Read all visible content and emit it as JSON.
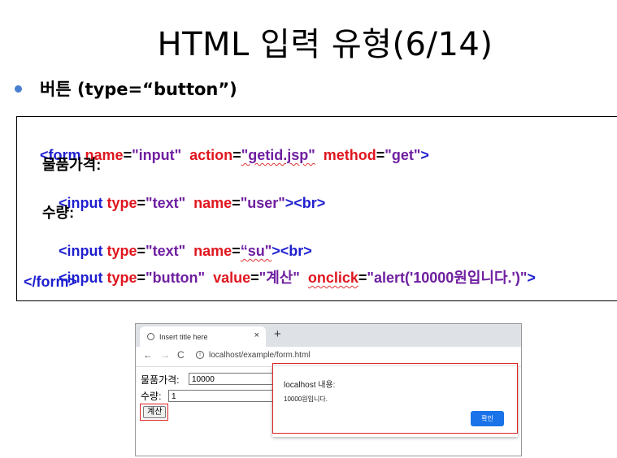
{
  "slide": {
    "title": "HTML 입력 유형(6/14)",
    "bullet": "버튼 (type=“button”)"
  },
  "code": {
    "l1_a": "<form ",
    "l1_b": "name",
    "l1_c": "=",
    "l1_d": "\"input\"",
    "l1_e": "  ",
    "l1_f": "action",
    "l1_g": "=",
    "l1_h": "\"getid.jsp\"",
    "l1_i": "  ",
    "l1_j": "method",
    "l1_k": "=",
    "l1_l": "\"get\"",
    "l1_m": ">",
    "l2": "물품가격:",
    "l3_a": "<input ",
    "l3_b": "type",
    "l3_c": "=",
    "l3_d": "\"text\"",
    "l3_e": "  ",
    "l3_f": "name",
    "l3_g": "=",
    "l3_h": "\"user\"",
    "l3_i": "><br>",
    "l4": "수량:",
    "l5_a": "<input ",
    "l5_b": "type",
    "l5_c": "=",
    "l5_d": "\"text\"",
    "l5_e": "  ",
    "l5_f": "name",
    "l5_g": "=",
    "l5_h": "“su\"",
    "l5_i": "><br>",
    "l6_a": "<input ",
    "l6_b": "type",
    "l6_c": "=",
    "l6_d": "\"button\"",
    "l6_e": "  ",
    "l6_f": "value",
    "l6_g": "=",
    "l6_h": "\"계산\"",
    "l6_i": "  ",
    "l6_j": "onclick",
    "l6_k": "=",
    "l6_l": "\"alert('10000원입니다.')\"",
    "l6_m": ">",
    "l7": "</form>"
  },
  "browser": {
    "tab_title": "Insert title here",
    "tab_close": "×",
    "new_tab": "+",
    "back": "←",
    "forward": "→",
    "reload": "C",
    "info": "i",
    "url": "localhost/example/form.html",
    "price_label": "물품가격:",
    "price_value": "10000",
    "qty_label": "수량:",
    "qty_value": "1",
    "button_label": "계산",
    "dialog_title": "localhost 내용:",
    "dialog_message": "10000원입니다.",
    "dialog_ok": "확인"
  },
  "colors": {
    "tag": "#1f1fcf",
    "attribute": "#e0161f",
    "value": "#6f1fa0",
    "highlight": "#d22222",
    "dialog_button": "#1a73e8"
  }
}
